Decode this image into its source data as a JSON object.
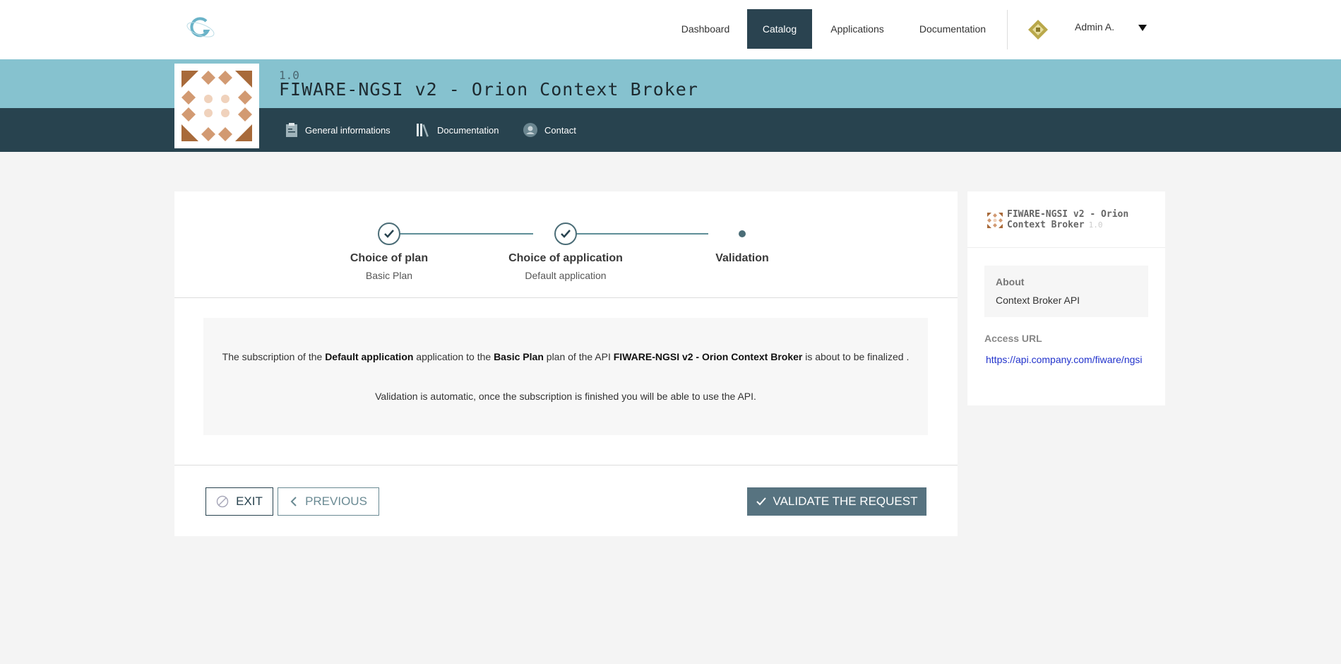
{
  "nav": {
    "items": [
      "Dashboard",
      "Catalog",
      "Applications",
      "Documentation"
    ],
    "active": "Catalog",
    "user": "Admin A."
  },
  "api": {
    "version": "1.0",
    "title": "FIWARE-NGSI v2 - Orion Context Broker"
  },
  "subnav": {
    "general": "General informations",
    "documentation": "Documentation",
    "contact": "Contact"
  },
  "steps": [
    {
      "title": "Choice of plan",
      "sub": "Basic Plan",
      "status": "done"
    },
    {
      "title": "Choice of application",
      "sub": "Default application",
      "status": "done"
    },
    {
      "title": "Validation",
      "sub": "",
      "status": "current"
    }
  ],
  "info": {
    "t1": "The subscription of the ",
    "app": "Default application",
    "t2": " application to the ",
    "plan": "Basic Plan",
    "t3": " plan of the API ",
    "api": "FIWARE-NGSI v2 - Orion Context Broker",
    "t4": " is about to be finalized .",
    "line2": "Validation is automatic, once the subscription is finished you will be able to use the API."
  },
  "buttons": {
    "exit": "EXIT",
    "previous": "PREVIOUS",
    "validate": "VALIDATE THE REQUEST"
  },
  "sidebar": {
    "title": "FIWARE-NGSI v2 - Orion Context Broker",
    "version": "1.0",
    "about_label": "About",
    "about_value": "Context Broker API",
    "access_label": "Access URL",
    "access_url": "https://api.company.com/fiware/ngsi"
  },
  "colors": {
    "accent_dark": "#28434f",
    "accent_light": "#86c2cf",
    "validate_button": "#577380"
  }
}
